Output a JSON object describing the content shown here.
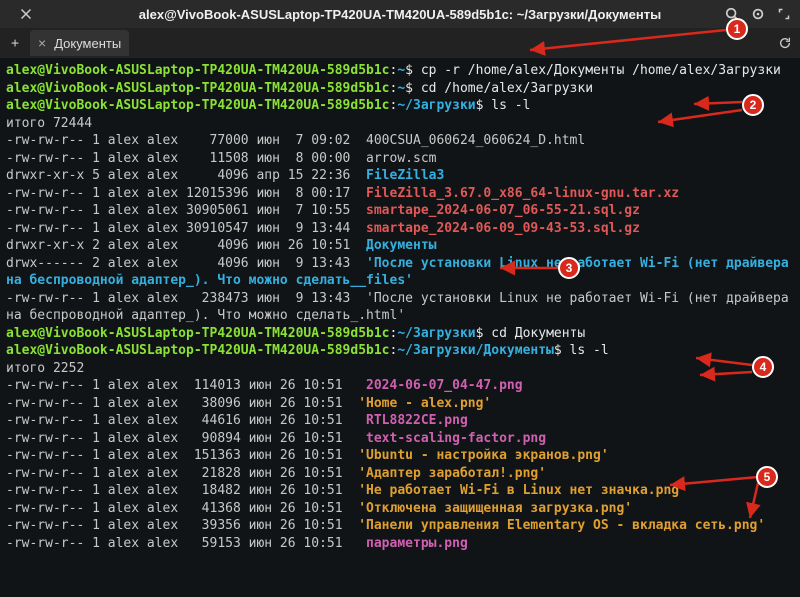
{
  "window": {
    "title": "alex@VivoBook-ASUSLaptop-TP420UA-TM420UA-589d5b1c: ~/Загрузки/Документы"
  },
  "tab": {
    "label": "Документы"
  },
  "prompt": {
    "userhost": "alex@VivoBook-ASUSLaptop-TP420UA-TM420UA-589d5b1c",
    "sep": ":",
    "home": "~",
    "dir_downloads": "~/Загрузки",
    "dir_docs": "~/Загрузки/Документы",
    "sigil": "$"
  },
  "cmds": {
    "cp": "cp -r /home/alex/Документы /home/alex/Загрузки",
    "cd_dl": "cd /home/alex/Загрузки",
    "ls": "ls -l",
    "total1": "итого 72444",
    "cd_docs": "cd Документы",
    "total2": "итого 2252"
  },
  "ls1": [
    {
      "perm": "-rw-rw-r--",
      "n": "1",
      "u": "alex",
      "g": "alex",
      "size": "   77000",
      "date": "июн  7 09:02",
      "name": "400CSUA_060624_060624_D.html",
      "cls": "c-dim"
    },
    {
      "perm": "-rw-rw-r--",
      "n": "1",
      "u": "alex",
      "g": "alex",
      "size": "   11508",
      "date": "июн  8 00:00",
      "name": "arrow.scm",
      "cls": "c-dim"
    },
    {
      "perm": "drwxr-xr-x",
      "n": "5",
      "u": "alex",
      "g": "alex",
      "size": "    4096",
      "date": "апр 15 22:36",
      "name": "FileZilla3",
      "cls": "c-blue"
    },
    {
      "perm": "-rw-rw-r--",
      "n": "1",
      "u": "alex",
      "g": "alex",
      "size": "12015396",
      "date": "июн  8 00:17",
      "name": "FileZilla_3.67.0_x86_64-linux-gnu.tar.xz",
      "cls": "c-red"
    },
    {
      "perm": "-rw-rw-r--",
      "n": "1",
      "u": "alex",
      "g": "alex",
      "size": "30905061",
      "date": "июн  7 10:55",
      "name": "smartape_2024-06-07_06-55-21.sql.gz",
      "cls": "c-red"
    },
    {
      "perm": "-rw-rw-r--",
      "n": "1",
      "u": "alex",
      "g": "alex",
      "size": "30910547",
      "date": "июн  9 13:44",
      "name": "smartape_2024-06-09_09-43-53.sql.gz",
      "cls": "c-red"
    },
    {
      "perm": "drwxr-xr-x",
      "n": "2",
      "u": "alex",
      "g": "alex",
      "size": "    4096",
      "date": "июн 26 10:51",
      "name": "Документы",
      "cls": "c-blue"
    },
    {
      "perm": "drwx------",
      "n": "2",
      "u": "alex",
      "g": "alex",
      "size": "    4096",
      "date": "июн  9 13:43",
      "name": "'После установки Linux не работает Wi-Fi (нет драйвера на беспроводной адаптер_). Что можно сделать__files'",
      "cls": "c-blue"
    },
    {
      "perm": "-rw-rw-r--",
      "n": "1",
      "u": "alex",
      "g": "alex",
      "size": "  238473",
      "date": "июн  9 13:43",
      "name": "'После установки Linux не работает Wi-Fi (нет драйвера на беспроводной адаптер_). Что можно сделать_.html'",
      "cls": "c-dim"
    }
  ],
  "ls2": [
    {
      "perm": "-rw-rw-r--",
      "n": "1",
      "u": "alex",
      "g": "alex",
      "size": " 114013",
      "date": "июн 26 10:51",
      "name": " 2024-06-07_04-47.png",
      "cls": "c-pink"
    },
    {
      "perm": "-rw-rw-r--",
      "n": "1",
      "u": "alex",
      "g": "alex",
      "size": "  38096",
      "date": "июн 26 10:51",
      "name": "'Home - alex.png'",
      "cls": "c-orange"
    },
    {
      "perm": "-rw-rw-r--",
      "n": "1",
      "u": "alex",
      "g": "alex",
      "size": "  44616",
      "date": "июн 26 10:51",
      "name": " RTL8822CE.png",
      "cls": "c-pink"
    },
    {
      "perm": "-rw-rw-r--",
      "n": "1",
      "u": "alex",
      "g": "alex",
      "size": "  90894",
      "date": "июн 26 10:51",
      "name": " text-scaling-factor.png",
      "cls": "c-pink"
    },
    {
      "perm": "-rw-rw-r--",
      "n": "1",
      "u": "alex",
      "g": "alex",
      "size": " 151363",
      "date": "июн 26 10:51",
      "name": "'Ubuntu - настройка экранов.png'",
      "cls": "c-orange"
    },
    {
      "perm": "-rw-rw-r--",
      "n": "1",
      "u": "alex",
      "g": "alex",
      "size": "  21828",
      "date": "июн 26 10:51",
      "name": "'Адаптер заработал!.png'",
      "cls": "c-orange"
    },
    {
      "perm": "-rw-rw-r--",
      "n": "1",
      "u": "alex",
      "g": "alex",
      "size": "  18482",
      "date": "июн 26 10:51",
      "name": "'Не работает Wi-Fi в Linux нет значка.png'",
      "cls": "c-orange"
    },
    {
      "perm": "-rw-rw-r--",
      "n": "1",
      "u": "alex",
      "g": "alex",
      "size": "  41368",
      "date": "июн 26 10:51",
      "name": "'Отключена защищенная загрузка.png'",
      "cls": "c-orange"
    },
    {
      "perm": "-rw-rw-r--",
      "n": "1",
      "u": "alex",
      "g": "alex",
      "size": "  39356",
      "date": "июн 26 10:51",
      "name": "'Панели управления Elementary OS - вкладка сеть.png'",
      "cls": "c-orange"
    },
    {
      "perm": "-rw-rw-r--",
      "n": "1",
      "u": "alex",
      "g": "alex",
      "size": "  59153",
      "date": "июн 26 10:51",
      "name": " параметры.png",
      "cls": "c-pink"
    }
  ],
  "annotations": [
    "1",
    "2",
    "3",
    "4",
    "5"
  ]
}
